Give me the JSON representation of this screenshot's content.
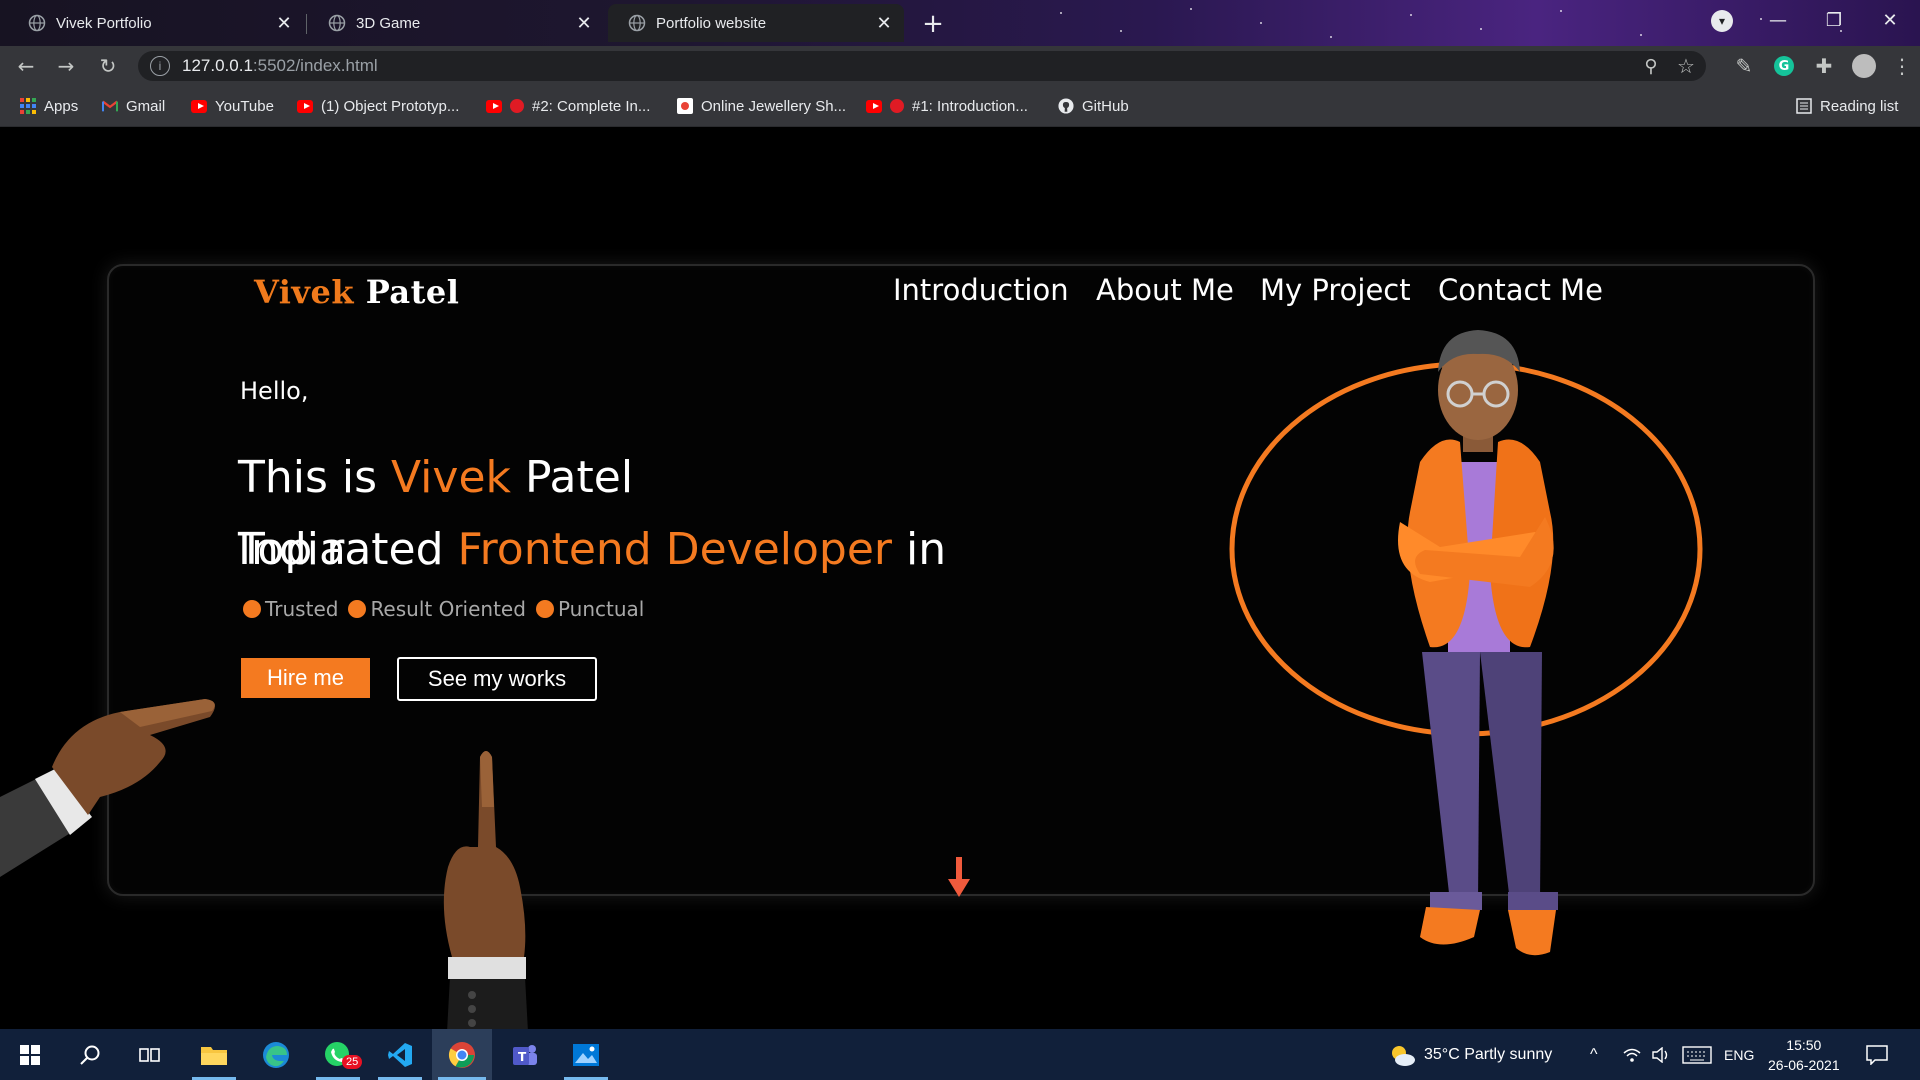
{
  "browser": {
    "tabs": [
      {
        "title": "Vivek Portfolio",
        "active": false
      },
      {
        "title": "3D Game",
        "active": false
      },
      {
        "title": "Portfolio website",
        "active": true
      }
    ],
    "url_host": "127.0.0.1",
    "url_path": ":5502/index.html",
    "bookmarks": [
      {
        "label": "Apps",
        "icon": "apps-grid-icon"
      },
      {
        "label": "Gmail",
        "icon": "gmail-icon"
      },
      {
        "label": "YouTube",
        "icon": "youtube-icon"
      },
      {
        "label": "(1) Object Prototyp...",
        "icon": "youtube-icon"
      },
      {
        "label": "#2: Complete In...",
        "icon": "youtube-icon"
      },
      {
        "label": "Online Jewellery Sh...",
        "icon": "site-icon"
      },
      {
        "label": "#1: Introduction...",
        "icon": "youtube-icon"
      },
      {
        "label": "GitHub",
        "icon": "github-icon"
      }
    ],
    "reading_list": "Reading list"
  },
  "page": {
    "brand_first": "Vivek",
    "brand_last": "Patel",
    "nav": [
      "Introduction",
      "About Me",
      "My Project",
      "Contact Me"
    ],
    "hello": "Hello,",
    "intro_prefix": "This is ",
    "intro_name_first": "Vivek",
    "intro_name_last": " Patel",
    "typed_a": "India",
    "typed_b": "Top rated",
    "role": "Frontend Developer",
    "role_suffix": " in",
    "tags": [
      "Trusted",
      "Result Oriented",
      "Punctual"
    ],
    "hire_label": "Hire me",
    "works_label": "See my works",
    "accent": "#f47a20"
  },
  "taskbar": {
    "whatsapp_badge": "25",
    "weather": "35°C  Partly sunny",
    "lang": "ENG",
    "time": "15:50",
    "date": "26-06-2021"
  }
}
